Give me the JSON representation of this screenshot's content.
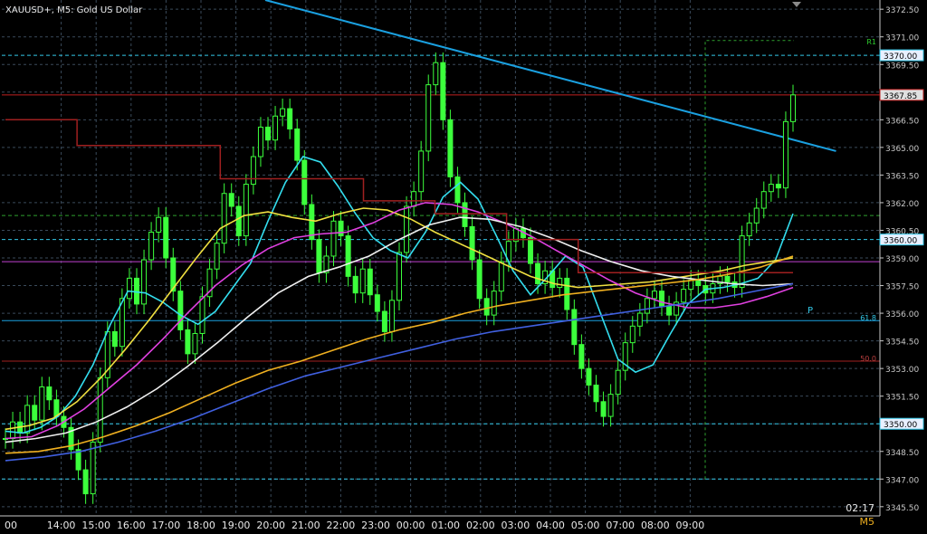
{
  "symbol_header": "XAUUSD+, M5:  Gold US Dollar",
  "timer": "02:17",
  "timeframe": "M5",
  "colors": {
    "background": "#000000",
    "grid": "#3a4a5a",
    "candle": "#3cff3c",
    "trendline": "#1aa0e0",
    "price_axis": "#c8c8c8",
    "ma_cyan": "#33ddee",
    "ma_yellow": "#f0e040",
    "ma_magenta": "#e040e0",
    "ma_white": "#f0f0f0",
    "ma_orange": "#f0b020",
    "ma_blue": "#4060e0",
    "pivot_step": "#a02020",
    "r1_line": "#2ea02e"
  },
  "chart_data": {
    "type": "candlestick",
    "symbol": "XAUUSD+",
    "timeframe": "M5",
    "ylim": [
      3345.0,
      3373.0
    ],
    "x_tick_labels": [
      "00",
      "14:00",
      "15:00",
      "16:00",
      "17:00",
      "18:00",
      "19:00",
      "20:00",
      "21:00",
      "22:00",
      "23:00",
      "00:00",
      "01:00",
      "02:00",
      "03:00",
      "04:00",
      "05:00",
      "07:00",
      "08:00",
      "09:00"
    ],
    "y_tick_labels": [
      "3372.50",
      "3371.00",
      "3369.50",
      "3368.00",
      "3366.50",
      "3365.00",
      "3363.50",
      "3362.00",
      "3360.50",
      "3359.00",
      "3357.50",
      "3356.00",
      "3354.50",
      "3353.00",
      "3351.50",
      "3350.00",
      "3348.50",
      "3347.00",
      "3345.50"
    ],
    "current_price": {
      "label": "3367.85",
      "value": 3367.85
    },
    "price_boxes": [
      {
        "label": "3370.00",
        "value": 3370.0
      },
      {
        "label": "3360.00",
        "value": 3360.0
      },
      {
        "label": "3350.00",
        "value": 3350.0
      }
    ],
    "horizontal_levels": [
      {
        "value": 3370.0,
        "color": "#33c8e8",
        "style": "dashed"
      },
      {
        "value": 3360.0,
        "color": "#33c8e8",
        "style": "dashed"
      },
      {
        "value": 3350.0,
        "color": "#33c8e8",
        "style": "dashed"
      },
      {
        "value": 3347.0,
        "color": "#33c8e8",
        "style": "dashed"
      },
      {
        "value": 3361.3,
        "color": "#2ea02e",
        "style": "dashed"
      },
      {
        "value": 3358.8,
        "color": "#c040d0",
        "style": "solid"
      },
      {
        "value": 3355.6,
        "color": "#1aa0e0",
        "style": "solid"
      },
      {
        "value": 3353.4,
        "color": "#a02020",
        "style": "solid"
      },
      {
        "value": 3367.85,
        "color": "#c02020",
        "style": "solid"
      }
    ],
    "pivot_labels": [
      {
        "text": "R1",
        "value": 3370.8
      },
      {
        "text": "P",
        "value": 3356.2
      },
      {
        "text": "61.8",
        "value": 3355.8
      },
      {
        "text": "50.0",
        "value": 3353.6
      }
    ],
    "trendline": {
      "from": {
        "x": 0.3,
        "value": 3373.0
      },
      "to": {
        "x": 0.95,
        "value": 3364.8
      }
    },
    "closes": [
      3349.2,
      3350.1,
      3349.5,
      3351.0,
      3350.2,
      3352.0,
      3351.3,
      3350.4,
      3349.8,
      3348.6,
      3347.5,
      3346.2,
      3349.0,
      3352.5,
      3355.0,
      3354.2,
      3356.8,
      3357.9,
      3356.5,
      3358.9,
      3360.4,
      3361.2,
      3359.0,
      3357.2,
      3355.1,
      3353.8,
      3354.9,
      3356.9,
      3358.4,
      3359.8,
      3362.5,
      3361.8,
      3360.2,
      3363.0,
      3364.5,
      3366.1,
      3365.4,
      3366.7,
      3367.1,
      3366.0,
      3364.3,
      3361.9,
      3360.0,
      3358.2,
      3359.1,
      3361.0,
      3360.2,
      3358.0,
      3357.1,
      3358.4,
      3357.0,
      3356.1,
      3355.0,
      3356.7,
      3359.3,
      3361.8,
      3362.6,
      3364.8,
      3368.4,
      3369.6,
      3366.5,
      3363.4,
      3362.0,
      3360.7,
      3358.9,
      3356.8,
      3355.9,
      3357.2,
      3358.8,
      3359.9,
      3360.6,
      3360.1,
      3358.7,
      3357.6,
      3358.3,
      3357.4,
      3357.9,
      3356.2,
      3354.3,
      3353.0,
      3352.1,
      3351.2,
      3350.4,
      3351.6,
      3352.9,
      3354.4,
      3355.3,
      3356.0,
      3356.8,
      3357.2,
      3356.4,
      3355.9,
      3356.6,
      3357.3,
      3357.8,
      3357.5,
      3357.1,
      3357.6,
      3358.0,
      3357.7,
      3357.4,
      3360.2,
      3360.9,
      3361.7,
      3362.6,
      3363.0,
      3362.8,
      3366.4,
      3367.85
    ],
    "series": [
      {
        "name": "",
        "color": "#33ddee",
        "values": [
          3349.6,
          3349.5,
          3349.8,
          3350.4,
          3351.5,
          3353.2,
          3355.4,
          3357.2,
          3357.1,
          3356.6,
          3355.9,
          3355.4,
          3356.1,
          3357.4,
          3358.7,
          3361.0,
          3363.1,
          3364.5,
          3364.2,
          3362.9,
          3361.4,
          3360.1,
          3359.4,
          3359.0,
          3360.4,
          3362.3,
          3363.1,
          3362.2,
          3360.3,
          3358.3,
          3357.0,
          3358.0,
          3359.1,
          3358.5,
          3356.0,
          3353.5,
          3352.8,
          3353.2,
          3354.9,
          3356.5,
          3357.3,
          3357.4,
          3357.6,
          3357.9,
          3358.9,
          3361.4
        ]
      },
      {
        "name": "",
        "color": "#f0e040",
        "values": [
          3349.7,
          3349.9,
          3350.3,
          3351.2,
          3352.5,
          3354.0,
          3355.6,
          3357.3,
          3359.0,
          3360.6,
          3361.3,
          3361.5,
          3361.2,
          3361.0,
          3361.4,
          3361.7,
          3361.6,
          3361.1,
          3360.4,
          3359.8,
          3359.2,
          3358.6,
          3358.0,
          3357.6,
          3357.4,
          3357.5,
          3357.6,
          3357.7,
          3357.9,
          3358.1,
          3358.3,
          3358.6,
          3358.8,
          3359.0
        ]
      },
      {
        "name": "",
        "color": "#e040e0",
        "values": [
          3349.2,
          3349.3,
          3349.9,
          3350.8,
          3352.0,
          3353.2,
          3354.6,
          3356.1,
          3357.5,
          3358.6,
          3359.5,
          3360.1,
          3360.3,
          3360.4,
          3360.9,
          3361.6,
          3362.0,
          3361.9,
          3361.5,
          3360.9,
          3360.2,
          3359.4,
          3358.6,
          3357.8,
          3357.1,
          3356.6,
          3356.3,
          3356.3,
          3356.5,
          3356.9,
          3357.4
        ]
      },
      {
        "name": "",
        "color": "#f0f0f0",
        "values": [
          3349.0,
          3349.2,
          3349.5,
          3350.1,
          3350.9,
          3351.9,
          3353.1,
          3354.4,
          3355.8,
          3357.1,
          3358.0,
          3358.5,
          3359.1,
          3360.0,
          3360.8,
          3361.2,
          3361.1,
          3360.7,
          3360.1,
          3359.4,
          3358.8,
          3358.3,
          3358.0,
          3357.8,
          3357.6,
          3357.5,
          3357.6
        ]
      },
      {
        "name": "",
        "color": "#f0b020",
        "values": [
          3348.4,
          3348.5,
          3348.8,
          3349.3,
          3349.9,
          3350.6,
          3351.4,
          3352.2,
          3352.9,
          3353.4,
          3354.0,
          3354.6,
          3355.1,
          3355.5,
          3356.0,
          3356.4,
          3356.7,
          3357.0,
          3357.2,
          3357.4,
          3357.6,
          3357.8,
          3358.1,
          3358.5,
          3359.1
        ]
      },
      {
        "name": "",
        "color": "#4060e0",
        "values": [
          3348.0,
          3348.2,
          3348.5,
          3349.0,
          3349.6,
          3350.3,
          3351.1,
          3351.9,
          3352.6,
          3353.1,
          3353.6,
          3354.1,
          3354.6,
          3355.0,
          3355.3,
          3355.6,
          3355.9,
          3356.2,
          3356.5,
          3356.8,
          3357.2,
          3357.6
        ]
      },
      {
        "name": "",
        "color": "#a02020",
        "values": [
          3366.5,
          3365.1,
          3365.1,
          3363.3,
          3363.3,
          3362.1,
          3361.4,
          3360.0,
          3358.2,
          3358.2,
          3358.2
        ]
      }
    ]
  }
}
